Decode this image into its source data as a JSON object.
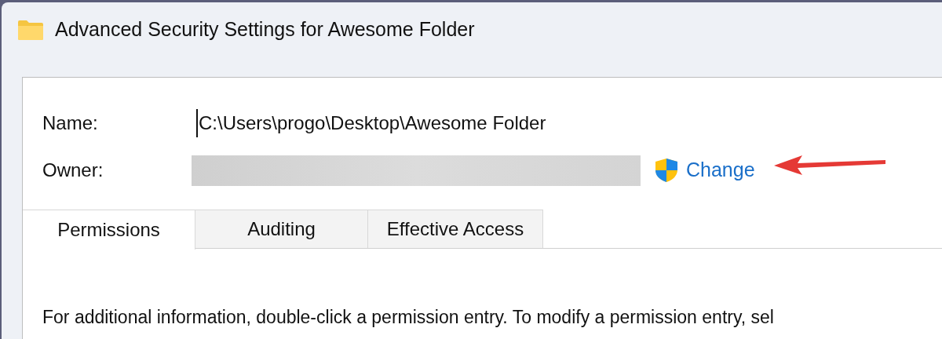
{
  "window": {
    "title": "Advanced Security Settings for Awesome Folder"
  },
  "fields": [
    {
      "kind": "text",
      "label": "Name:",
      "value": "C:\\Users\\progo\\Desktop\\Awesome Folder",
      "caret": true
    },
    {
      "kind": "owner",
      "label": "Owner:",
      "redacted": true,
      "link": "Change"
    }
  ],
  "tabs": [
    {
      "label": "Permissions",
      "selected": true
    },
    {
      "label": "Auditing",
      "selected": false
    },
    {
      "label": "Effective Access",
      "selected": false
    }
  ],
  "info_text": "For additional information, double-click a permission entry. To modify a permission entry, sel",
  "annotations": [
    {
      "kind": "arrow"
    }
  ]
}
